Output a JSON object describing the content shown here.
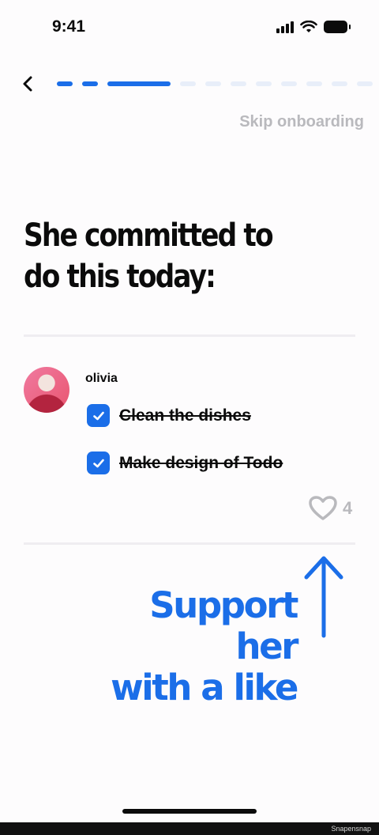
{
  "status_bar": {
    "time": "9:41"
  },
  "onboarding": {
    "progress": {
      "completed_steps": 3,
      "total_steps": 11
    },
    "skip_label": "Skip onboarding"
  },
  "heading": {
    "line1": "She committed to",
    "line2": "do this today:"
  },
  "post": {
    "username": "olivia",
    "tasks": [
      {
        "label": "Clean the dishes",
        "done": true
      },
      {
        "label": "Make design of Todo",
        "done": true
      }
    ],
    "likes": "4"
  },
  "callout": {
    "line1": "Support her",
    "line2": "with a like"
  },
  "watermark": "Snapensnap",
  "colors": {
    "accent": "#1b6ee8",
    "muted": "#b9b9bd",
    "track": "#e8eef9",
    "text": "#0b0b0b"
  },
  "icons": {
    "back": "chevron-left-icon",
    "check": "checkmark-icon",
    "like": "heart-outline-icon",
    "arrow": "arrow-up-icon"
  }
}
